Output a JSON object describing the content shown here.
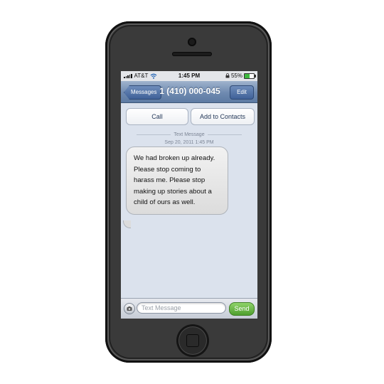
{
  "statusbar": {
    "carrier": "AT&T",
    "time": "1:45 PM",
    "battery_text": "55%",
    "battery_level": 0.55
  },
  "navbar": {
    "back_label": "Messages",
    "title": "1 (410) 000-045",
    "edit_label": "Edit"
  },
  "actions": {
    "call_label": "Call",
    "add_contacts_label": "Add to Contacts"
  },
  "thread": {
    "message_type": "Text Message",
    "date": "Sep 20, 2011 1:45 PM",
    "messages": [
      "We had broken up already. Please stop coming to harass me. Please stop making up stories about a child of ours as well."
    ]
  },
  "composer": {
    "placeholder": "Text Message",
    "send_label": "Send"
  },
  "colors": {
    "send_green": "#5cb037",
    "nav_blue": "#6f8ab0",
    "screen_bg": "#dbe2ed"
  }
}
